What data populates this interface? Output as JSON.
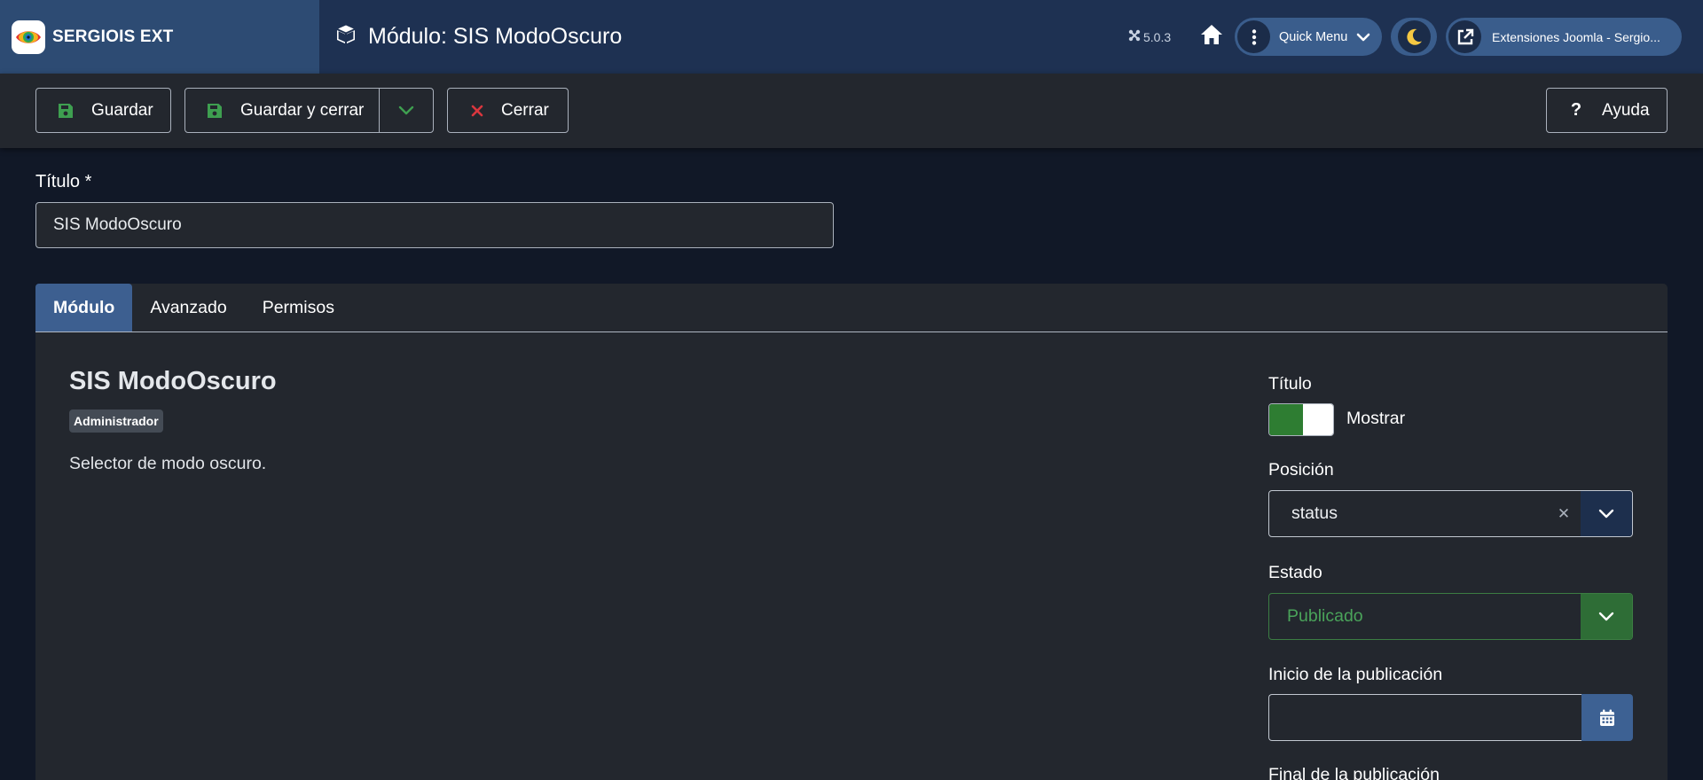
{
  "header": {
    "brand": "SERGIOIS EXT",
    "page_title": "Módulo: SIS ModoOscuro",
    "version": "5.0.3",
    "quick_menu_label": "Quick Menu",
    "external_link_label": "Extensiones Joomla - Sergio..."
  },
  "toolbar": {
    "save_label": "Guardar",
    "save_close_label": "Guardar y cerrar",
    "close_label": "Cerrar",
    "help_label": "Ayuda"
  },
  "form": {
    "title_label": "Título *",
    "title_value": "SIS ModoOscuro"
  },
  "tabs": [
    {
      "label": "Módulo",
      "active": true
    },
    {
      "label": "Avanzado",
      "active": false
    },
    {
      "label": "Permisos",
      "active": false
    }
  ],
  "module": {
    "name": "SIS ModoOscuro",
    "badge": "Administrador",
    "description": "Selector de modo oscuro."
  },
  "options": {
    "title_label": "Título",
    "title_toggle_label": "Mostrar",
    "title_toggle_on": true,
    "position_label": "Posición",
    "position_value": "status",
    "state_label": "Estado",
    "state_value": "Publicado",
    "publish_up_label": "Inicio de la publicación",
    "publish_up_value": "",
    "publish_down_label": "Final de la publicación"
  },
  "colors": {
    "header_bg": "#1e3152",
    "brand_bg": "#2d4b73",
    "page_bg": "#111827",
    "panel_bg": "#23272e",
    "accent": "#3d5f90",
    "success": "#2e7d32",
    "danger": "#d9363e"
  }
}
